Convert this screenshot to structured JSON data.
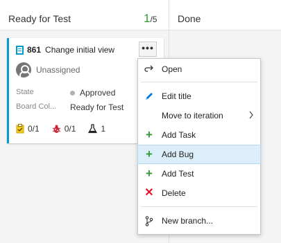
{
  "board": {
    "column_ready": "Ready for Test",
    "wip_count": "1",
    "wip_limit": "/5",
    "column_done": "Done"
  },
  "card": {
    "id": "861",
    "title": "Change initial view",
    "more": "•••",
    "assignee": "Unassigned",
    "state_label": "State",
    "state_value": "Approved",
    "board_col_label": "Board Col...",
    "board_col_value": "Ready for Test",
    "tasks": "0/1",
    "bugs": "0/1",
    "tests": "1",
    "accent_color": "#009ccc",
    "state_color": "#b2b2b2"
  },
  "menu": {
    "open": "Open",
    "edit_title": "Edit title",
    "move_to_iteration": "Move to iteration",
    "add_task": "Add Task",
    "add_bug": "Add Bug",
    "add_test": "Add Test",
    "delete": "Delete",
    "new_branch": "New branch...",
    "highlighted_item": "Add Bug",
    "icons": [
      "open-arrow-icon",
      "pencil-icon",
      "plus-icon",
      "plus-icon",
      "plus-icon",
      "delete-x-icon",
      "branch-icon"
    ]
  }
}
